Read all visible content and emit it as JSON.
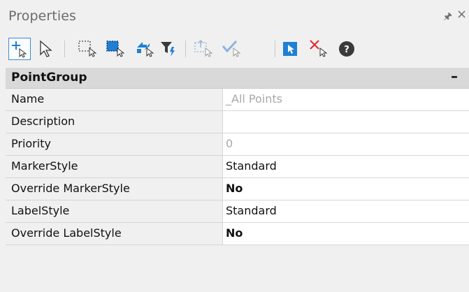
{
  "panel": {
    "title": "Properties",
    "pin_icon": "pin-icon",
    "close_icon": "close-icon"
  },
  "toolbar": {
    "buttons": [
      {
        "name": "add-selection-button",
        "icon": "plus-arrow-icon"
      },
      {
        "name": "select-objects-button",
        "icon": "arrow-cursor-icon"
      },
      {
        "name": "window-select-button",
        "icon": "dotted-rect-icon"
      },
      {
        "name": "crossing-select-button",
        "icon": "blue-dotted-rect-icon"
      },
      {
        "name": "swap-selection-button",
        "icon": "swap-arrows-icon"
      },
      {
        "name": "quick-filter-button",
        "icon": "filter-icon"
      },
      {
        "name": "export-selection-button",
        "icon": "export-icon"
      },
      {
        "name": "check-selection-button",
        "icon": "checkmark-icon"
      },
      {
        "name": "highlight-button",
        "icon": "blue-cursor-icon"
      },
      {
        "name": "deselect-button",
        "icon": "red-x-icon"
      },
      {
        "name": "help-button",
        "icon": "help-icon"
      }
    ]
  },
  "section": {
    "label": "PointGroup",
    "collapse_symbol": "–"
  },
  "properties": [
    {
      "name": "Name",
      "value": "_All Points",
      "readonly": true
    },
    {
      "name": "Description",
      "value": "",
      "readonly": false
    },
    {
      "name": "Priority",
      "value": "0",
      "readonly": true
    },
    {
      "name": "MarkerStyle",
      "value": "Standard",
      "readonly": false
    },
    {
      "name": "Override MarkerStyle",
      "value": "No",
      "readonly": false
    },
    {
      "name": "LabelStyle",
      "value": "Standard",
      "readonly": false
    },
    {
      "name": "Override LabelStyle",
      "value": "No",
      "readonly": false
    }
  ],
  "colors": {
    "accent": "#1e7fd4",
    "danger": "#e0262b",
    "section_bg": "#d9d9d9",
    "panel_bg": "#f0f0f0"
  }
}
